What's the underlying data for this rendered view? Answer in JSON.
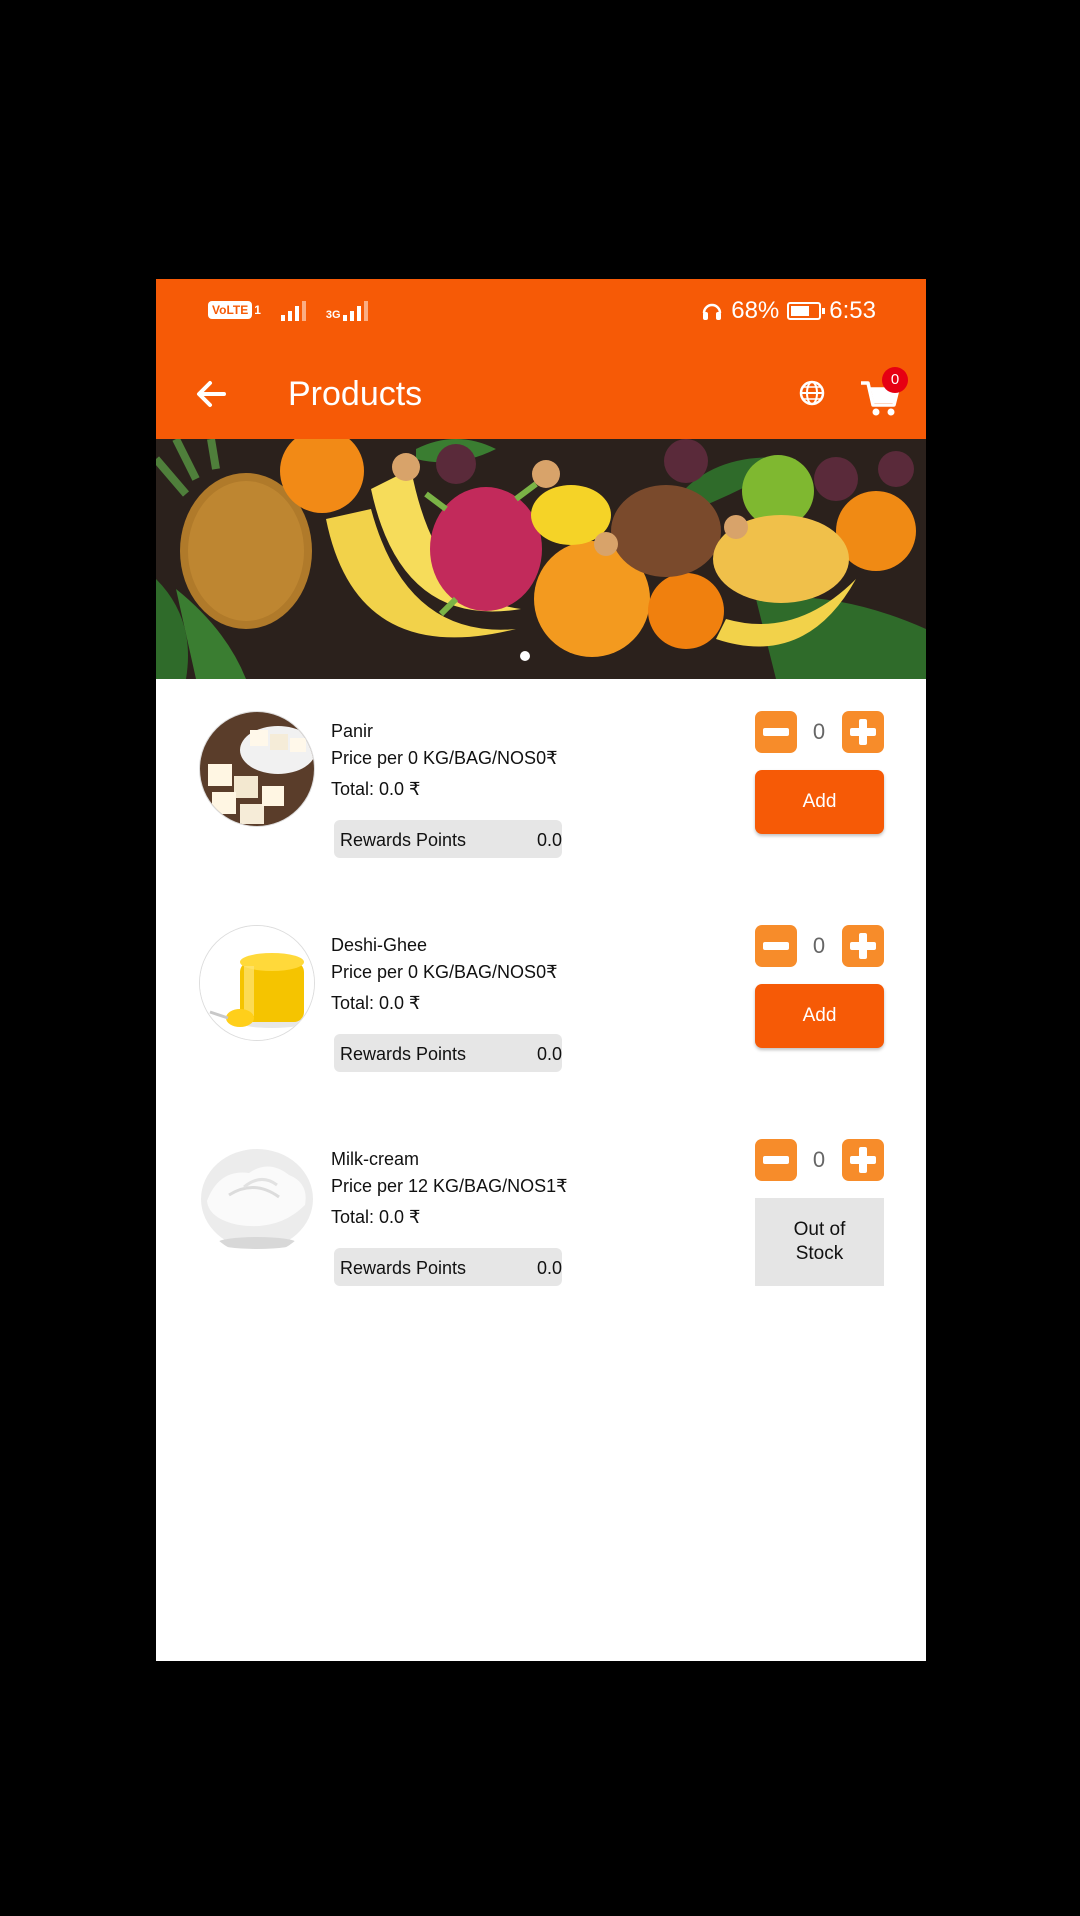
{
  "status_bar": {
    "volte": "VoLTE",
    "sim1": "1",
    "net_type": "3G",
    "battery_percent": "68%",
    "battery_level": 0.68,
    "time": "6:53"
  },
  "app_bar": {
    "title": "Products",
    "back_icon": "arrow-left-icon",
    "language_icon": "globe-icon",
    "cart_icon": "cart-icon",
    "cart_count": "0"
  },
  "banner": {
    "image": "fruits-banner",
    "active_slide": 1
  },
  "colors": {
    "primary": "#f65a06",
    "stepper": "#f78c2a",
    "badge": "#e60012"
  },
  "products": [
    {
      "name": "Panir",
      "price": "Price per 0 KG/BAG/NOS0₹",
      "total": "Total: 0.0 ₹",
      "rewards_label": "Rewards Points",
      "rewards_value": "0.0",
      "quantity": "0",
      "action_label": "Add"
    },
    {
      "name": "Deshi-Ghee",
      "price": "Price per 0 KG/BAG/NOS0₹",
      "total": "Total: 0.0 ₹",
      "rewards_label": "Rewards Points",
      "rewards_value": "0.0",
      "quantity": "0",
      "action_label": "Add"
    },
    {
      "name": "Milk-cream",
      "price": "Price per 12 KG/BAG/NOS1₹",
      "total": "Total: 0.0 ₹",
      "rewards_label": "Rewards Points",
      "rewards_value": "0.0",
      "quantity": "0",
      "action_label_line1": "Out of",
      "action_label_line2": "Stock"
    }
  ]
}
